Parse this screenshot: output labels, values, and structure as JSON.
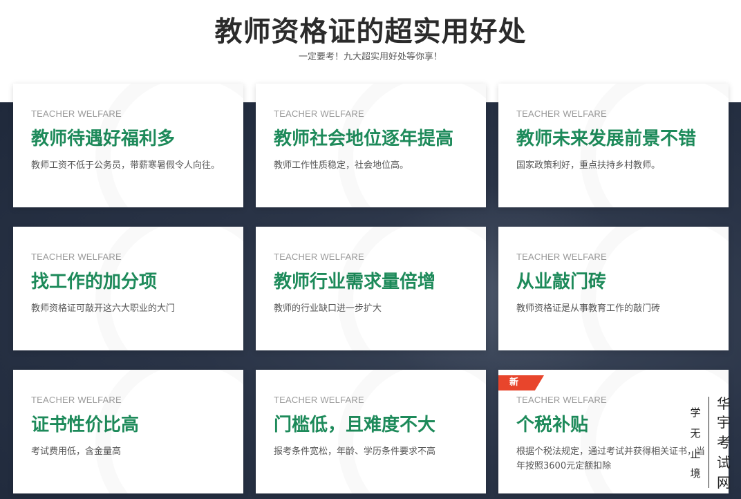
{
  "header": {
    "title": "教师资格证的超实用好处",
    "subtitle": "一定要考！九大超实用好处等你享！"
  },
  "cards": [
    {
      "tag": "TEACHER WELFARE",
      "title": "教师待遇好福利多",
      "desc": "教师工资不低于公务员，带薪寒暑假令人向往。"
    },
    {
      "tag": "TEACHER WELFARE",
      "title": "教师社会地位逐年提高",
      "desc": "教师工作性质稳定，社会地位高。"
    },
    {
      "tag": "TEACHER WELFARE",
      "title": "教师未来发展前景不错",
      "desc": "国家政策利好，重点扶持乡村教师。"
    },
    {
      "tag": "TEACHER WELFARE",
      "title": "找工作的加分项",
      "desc": "教师资格证可敲开这六大职业的大门"
    },
    {
      "tag": "TEACHER WELFARE",
      "title": "教师行业需求量倍增",
      "desc": "教师的行业缺口进一步扩大"
    },
    {
      "tag": "TEACHER WELFARE",
      "title": "从业敲门砖",
      "desc": "教师资格证是从事教育工作的敲门砖"
    },
    {
      "tag": "TEACHER WELFARE",
      "title": "证书性价比高",
      "desc": "考试费用低，含金量高"
    },
    {
      "tag": "TEACHER WELFARE",
      "title": "门槛低，且难度不大",
      "desc": "报考条件宽松，年龄、学历条件要求不高"
    },
    {
      "tag": "TEACHER WELFARE",
      "title": "个税补贴",
      "desc": "根据个税法规定，通过考试并获得相关证书，当年按照3600元定额扣除",
      "badge": "新"
    }
  ],
  "watermark": {
    "small": [
      "学",
      "无",
      "止",
      "境"
    ],
    "big": [
      "华",
      "宇",
      "考",
      "试",
      "网"
    ]
  }
}
